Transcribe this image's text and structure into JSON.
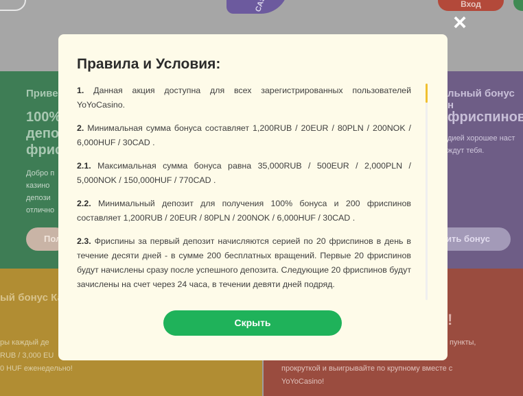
{
  "header": {
    "logo_text": "CAS",
    "login_label": "Вход"
  },
  "background": {
    "left_panel": {
      "title": "Приве",
      "big_line1": "100%",
      "big_line2": "депо",
      "big_line3": "фрис",
      "text1": "Добро п",
      "text2": "казино",
      "text3": "депози",
      "text4": "отлично",
      "button": "Пол"
    },
    "right_panel": {
      "title": "льный бонус н",
      "big": "фриспинов",
      "text1": "дией хорошее наст",
      "text2": "ждут тебя.",
      "button": "ить бонус"
    },
    "bottom_left": {
      "title": "ый бонус Ка",
      "text1": "ры каждый де",
      "text2": "RUB / 3,000 EU",
      "text3": "0 HUF еженедельно!"
    },
    "bottom_right": {
      "exclaim": "!",
      "text1": "пункты,",
      "text2": "прокруткой и выигрывайте по крупному вместе с",
      "text3": "YoYoCasino!"
    }
  },
  "modal": {
    "title": "Правила и Условия:",
    "close_icon": "×",
    "rules": [
      {
        "num": "1.",
        "text": "Данная акция доступна для всех зарегистрированных пользователей YoYoCasino."
      },
      {
        "num": "2.",
        "text": "Минимальная сумма бонуса составляет 1,200RUB / 20EUR / 80PLN / 200NOK / 6,000HUF / 30CAD ."
      },
      {
        "num": "2.1.",
        "text": "Максимальная сумма бонуса равна 35,000RUB / 500EUR / 2,000PLN / 5,000NOK / 150,000HUF / 770CAD ."
      },
      {
        "num": "2.2.",
        "text": "Минимальный депозит для получения 100% бонуса и 200 фриспинов составляет 1,200RUB / 20EUR / 80PLN / 200NOK / 6,000HUF / 30CAD ."
      },
      {
        "num": "2.3.",
        "text": "Фриспины за первый депозит начисляются серией по 20 фриспинов в день в течение десяти дней - в сумме 200 бесплатных вращений. Первые 20 фриспинов будут начислены сразу после успешного депозита. Следующие 20 фриспинов будут зачислены на счет через 24 часа, в течении девяти дней подряд."
      }
    ],
    "hide_button": "Скрыть"
  },
  "colors": {
    "modal_bg": "#fefbe9",
    "button_green": "#1fb25a",
    "scroll_thumb": "#f0c030"
  }
}
